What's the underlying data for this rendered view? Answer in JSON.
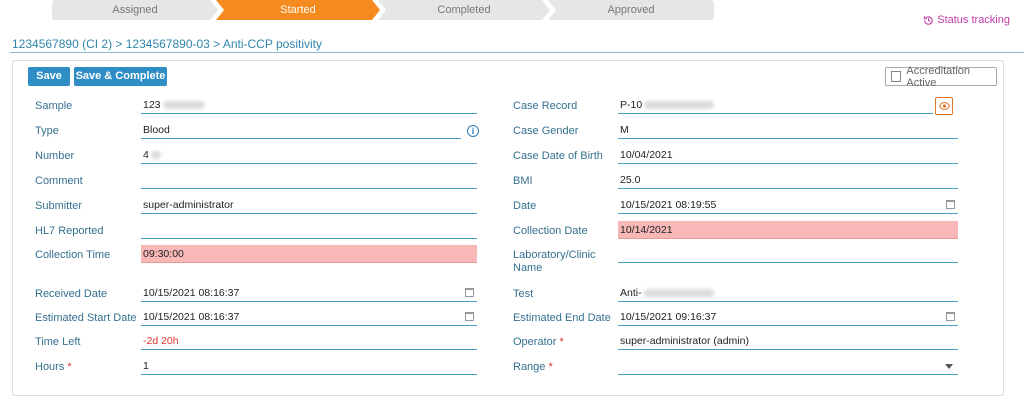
{
  "steps": [
    "Assigned",
    "Started",
    "Completed",
    "Approved"
  ],
  "status_tracking": "Status tracking",
  "breadcrumb": "1234567890 (CI 2) > 1234567890-03 > Anti-CCP positivity",
  "buttons": {
    "save": "Save",
    "save_complete": "Save & Complete"
  },
  "accreditation": "Accreditation Active",
  "left": {
    "sample": {
      "label": "Sample",
      "value": "123"
    },
    "type": {
      "label": "Type",
      "value": "Blood"
    },
    "number": {
      "label": "Number",
      "value": "4"
    },
    "comment": {
      "label": "Comment",
      "value": ""
    },
    "submitter": {
      "label": "Submitter",
      "value": "super-administrator"
    },
    "hl7": {
      "label": "HL7 Reported",
      "value": ""
    },
    "collection_time": {
      "label": "Collection Time",
      "value": "09:30:00"
    },
    "received_date": {
      "label": "Received Date",
      "value": "10/15/2021 08:16:37"
    },
    "est_start": {
      "label": "Estimated Start Date",
      "value": "10/15/2021 08:16:37"
    },
    "time_left": {
      "label": "Time Left",
      "value": "-2d 20h"
    },
    "hours": {
      "label": "Hours",
      "value": "1"
    }
  },
  "right": {
    "case_record": {
      "label": "Case Record",
      "value": "P-10"
    },
    "case_gender": {
      "label": "Case Gender",
      "value": "M"
    },
    "case_dob": {
      "label": "Case Date of Birth",
      "value": "10/04/2021"
    },
    "bmi": {
      "label": "BMI",
      "value": "25.0"
    },
    "date": {
      "label": "Date",
      "value": "10/15/2021 08:19:55"
    },
    "collection_date": {
      "label": "Collection Date",
      "value": "10/14/2021"
    },
    "lab_clinic": {
      "label": "Laboratory/Clinic Name",
      "value": ""
    },
    "test": {
      "label": "Test",
      "value": "Anti-"
    },
    "est_end": {
      "label": "Estimated End Date",
      "value": "10/15/2021 09:16:37"
    },
    "operator": {
      "label": "Operator",
      "value": "super-administrator  (admin)"
    },
    "range": {
      "label": "Range",
      "value": ""
    }
  },
  "required_marker": "*",
  "colors": {
    "accent": "#f58a1f",
    "primary": "#2d8dc4",
    "highlight": "#f8b8b8",
    "link": "#2f86ad"
  }
}
